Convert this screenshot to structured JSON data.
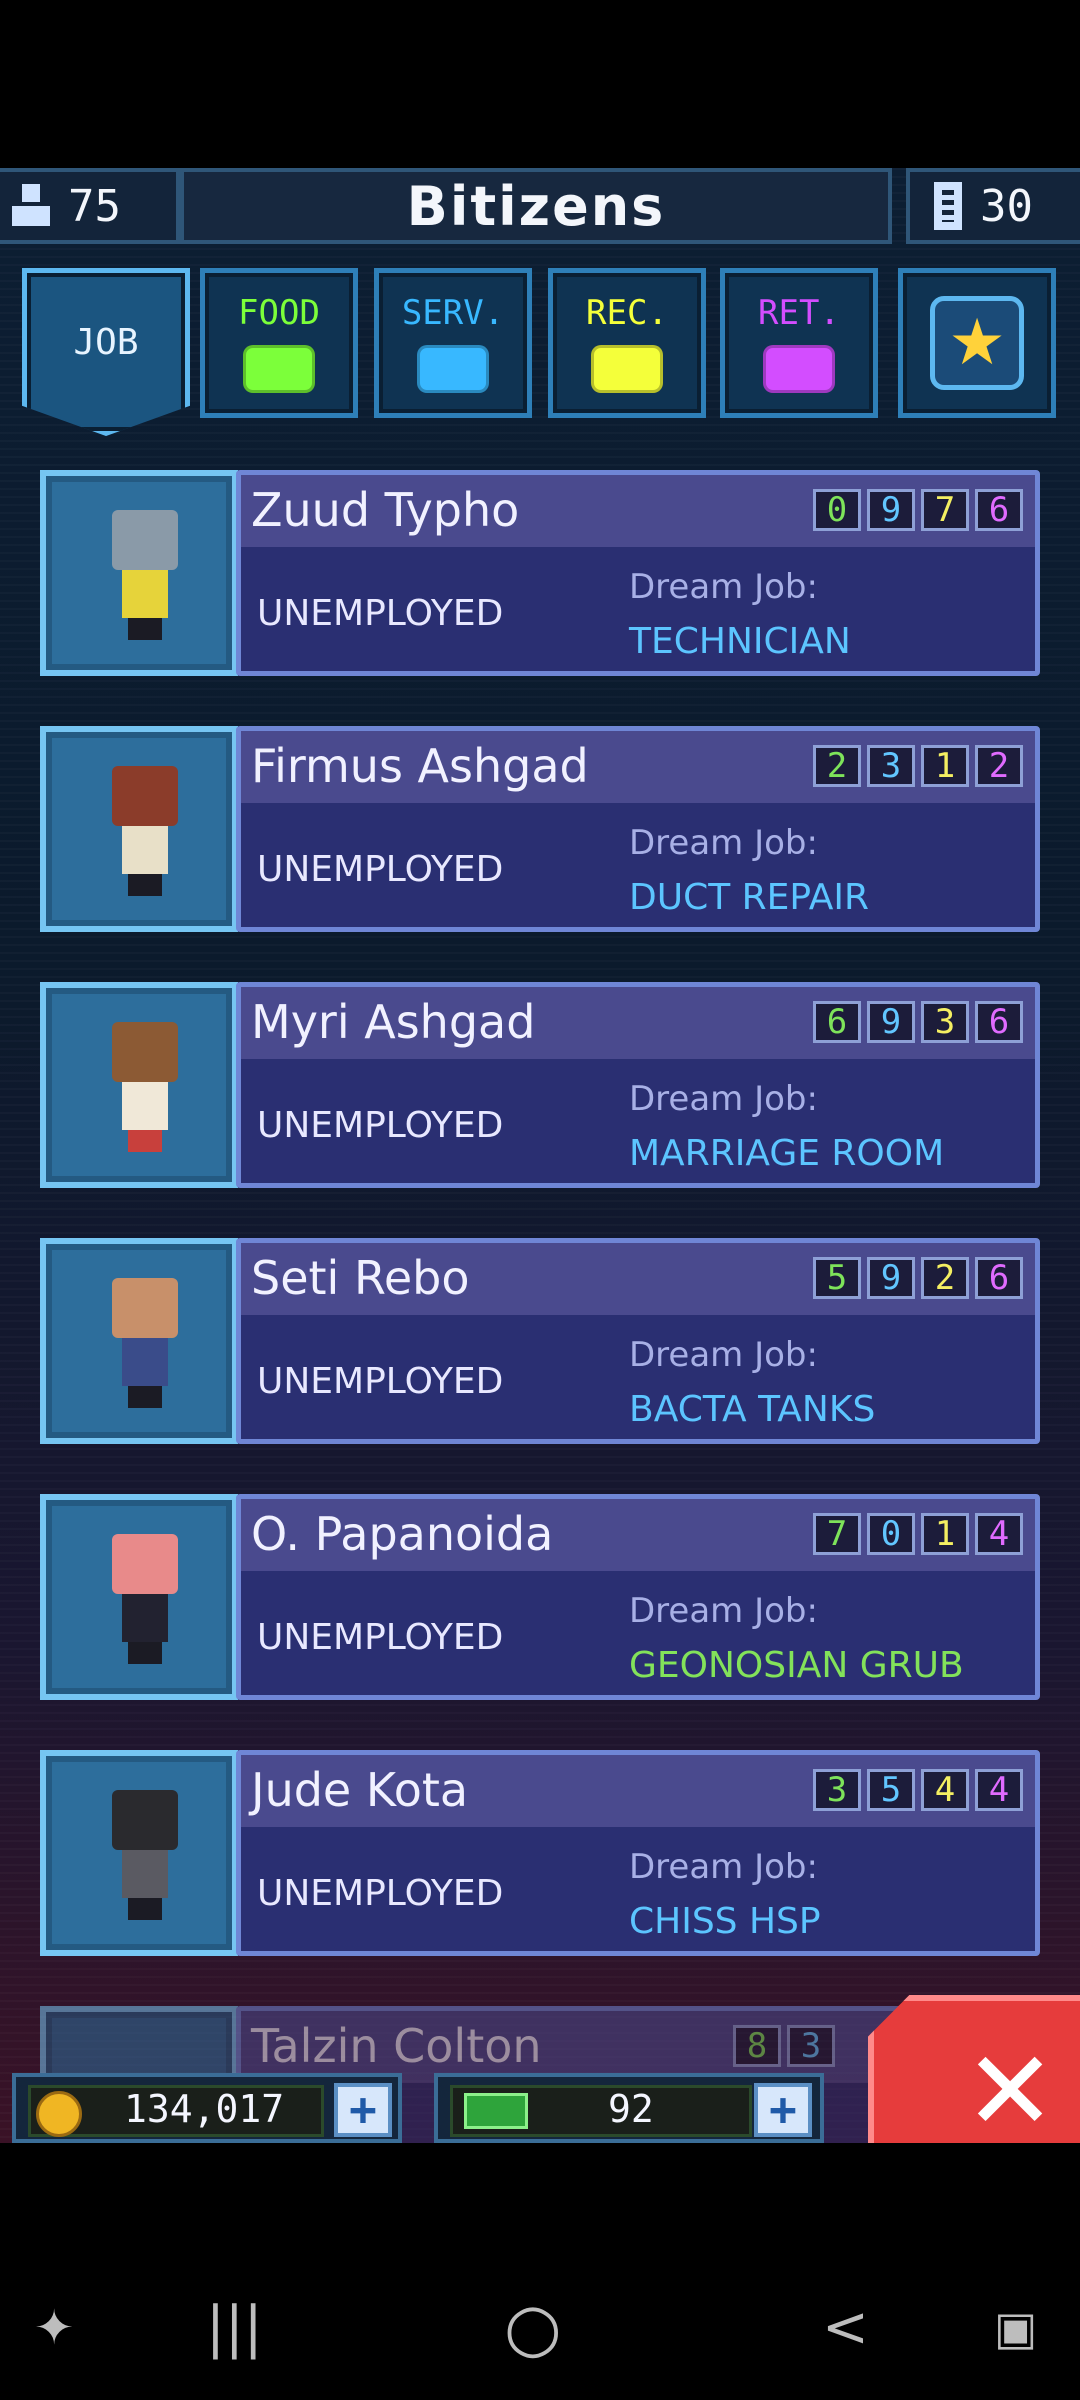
{
  "header": {
    "title": "Bitizens",
    "population": "75",
    "floors": "30",
    "population_icon": "person-icon",
    "floors_icon": "elevator-icon"
  },
  "tabs": [
    {
      "label": "JOB",
      "active": true
    },
    {
      "label": "FOOD",
      "color": "#7cff3a"
    },
    {
      "label": "SERV.",
      "color": "#38b8ff"
    },
    {
      "label": "REC.",
      "color": "#f4ff3a"
    },
    {
      "label": "RET.",
      "color": "#d34dff"
    },
    {
      "label": "",
      "icon": "star-icon"
    }
  ],
  "dream_job_label": "Dream Job:",
  "bitizens": [
    {
      "name": "Zuud Typho",
      "stats": [
        "0",
        "9",
        "7",
        "6"
      ],
      "status": "UNEMPLOYED",
      "dream_job": "TECHNICIAN",
      "dream_job_color": "blue"
    },
    {
      "name": "Firmus Ashgad",
      "stats": [
        "2",
        "3",
        "1",
        "2"
      ],
      "status": "UNEMPLOYED",
      "dream_job": "DUCT REPAIR",
      "dream_job_color": "blue"
    },
    {
      "name": "Myri Ashgad",
      "stats": [
        "6",
        "9",
        "3",
        "6"
      ],
      "status": "UNEMPLOYED",
      "dream_job": "MARRIAGE ROOM",
      "dream_job_color": "blue"
    },
    {
      "name": "Seti Rebo",
      "stats": [
        "5",
        "9",
        "2",
        "6"
      ],
      "status": "UNEMPLOYED",
      "dream_job": "BACTA TANKS",
      "dream_job_color": "blue"
    },
    {
      "name": "O. Papanoida",
      "stats": [
        "7",
        "0",
        "1",
        "4"
      ],
      "status": "UNEMPLOYED",
      "dream_job": "GEONOSIAN GRUB",
      "dream_job_color": "green"
    },
    {
      "name": "Jude Kota",
      "stats": [
        "3",
        "5",
        "4",
        "4"
      ],
      "status": "UNEMPLOYED",
      "dream_job": "CHISS HSP",
      "dream_job_color": "blue"
    },
    {
      "name": "Talzin Colton",
      "stats": [
        "8",
        "3"
      ],
      "status": "",
      "dream_job": "",
      "dream_job_color": "blue"
    }
  ],
  "currency": {
    "coins": "134,017",
    "bux": "92",
    "coin_icon": "coin-icon",
    "bux_icon": "cash-icon",
    "add_label": "+",
    "close_label": "✕"
  },
  "android_nav": {
    "game_icon": "game-launcher-icon",
    "recents": "|||",
    "home": "○",
    "back": "<",
    "screenshot_icon": "capture-icon"
  }
}
